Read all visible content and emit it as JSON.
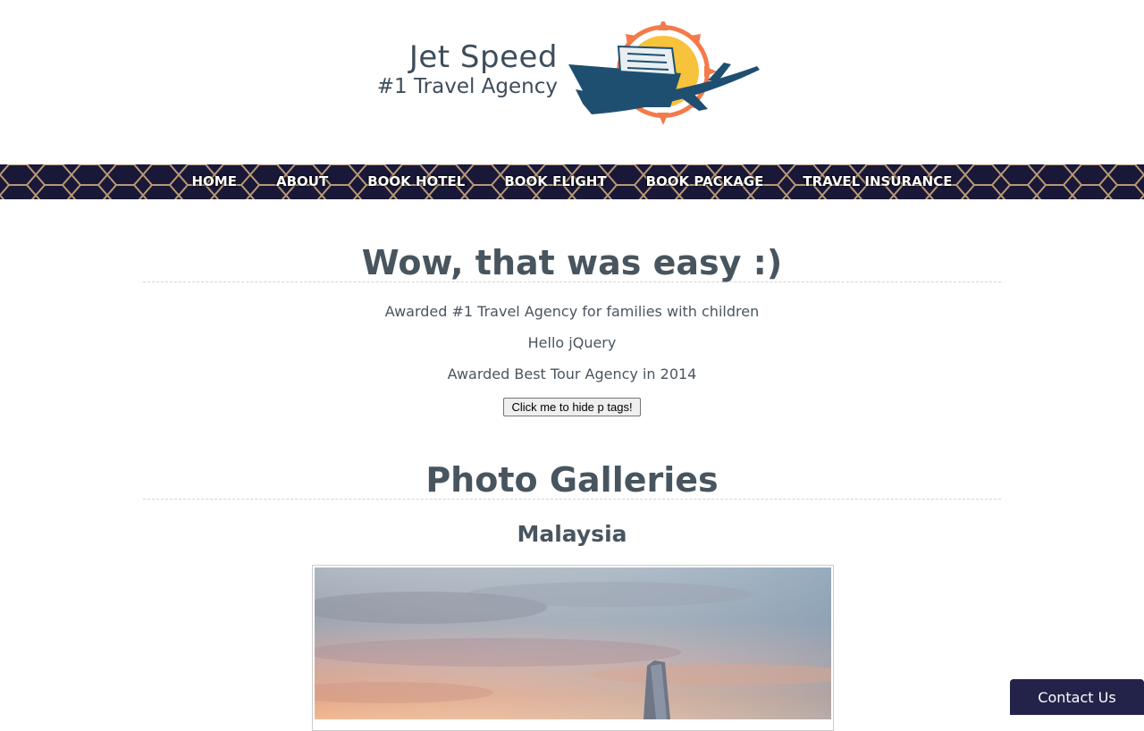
{
  "header": {
    "logo_title": "Jet Speed",
    "logo_subtitle": "#1 Travel Agency"
  },
  "nav": {
    "items": [
      "HOME",
      "ABOUT",
      "BOOK HOTEL",
      "BOOK FLIGHT",
      "BOOK PACKAGE",
      "TRAVEL INSURANCE"
    ]
  },
  "intro": {
    "heading": "Wow, that was easy :)",
    "paragraphs": [
      "Awarded #1 Travel Agency for families with children",
      "Hello jQuery",
      "Awarded Best Tour Agency in 2014"
    ],
    "button_label": "Click me to hide p tags!"
  },
  "gallery": {
    "heading": "Photo Galleries",
    "subheading": "Malaysia"
  },
  "contact": {
    "label": "Contact Us"
  },
  "colors": {
    "nav_bg": "#1a1838",
    "nav_pattern": "#c9a97a",
    "heading": "#48555f",
    "contact_bg": "#23234a"
  }
}
